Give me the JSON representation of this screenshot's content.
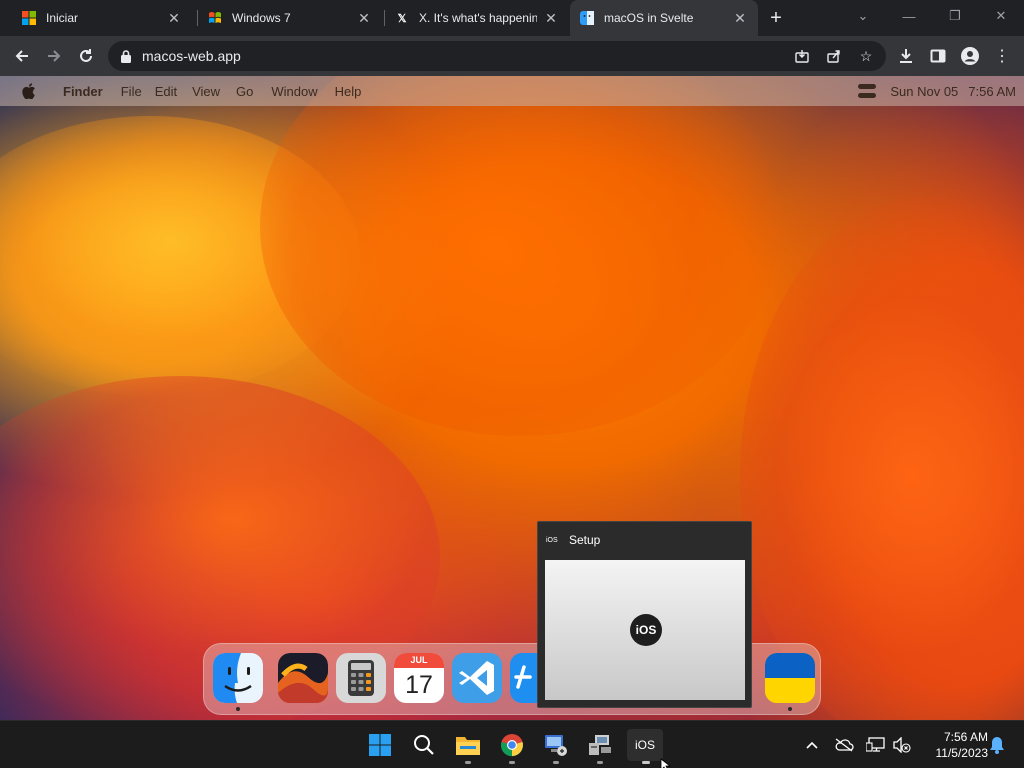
{
  "browser": {
    "tabs": [
      {
        "title": "Iniciar",
        "icon": "windows-logo-icon",
        "active": false
      },
      {
        "title": "Windows 7",
        "icon": "windows7-logo-icon",
        "active": false
      },
      {
        "title": "X. It's what's happening",
        "icon": "x-logo-icon",
        "active": false
      },
      {
        "title": "macOS in Svelte",
        "icon": "finder-icon",
        "active": true
      }
    ],
    "new_tab_label": "+",
    "url": "macos-web.app"
  },
  "macos": {
    "menubar": {
      "items": [
        "Finder",
        "File",
        "Edit",
        "View",
        "Go",
        "Window",
        "Help"
      ],
      "date": "Sun Nov 05",
      "time": "7:56 AM"
    },
    "dock": {
      "apps": [
        {
          "name": "Finder",
          "icon": "finder-icon",
          "running": true
        },
        {
          "name": "Wallpapers",
          "icon": "wallpaper-icon",
          "running": false
        },
        {
          "name": "Calculator",
          "icon": "calculator-icon",
          "running": false
        },
        {
          "name": "Calendar",
          "icon": "calendar-icon",
          "running": false,
          "month": "JUL",
          "day": "17"
        },
        {
          "name": "VS Code",
          "icon": "vscode-icon",
          "running": false
        },
        {
          "name": "App Store",
          "icon": "app-store-icon",
          "running": false
        },
        {
          "name": "Ukraine",
          "icon": "ukraine-flag-icon",
          "running": true
        }
      ]
    }
  },
  "thumbnail": {
    "icon_label": "iOS",
    "title": "Setup",
    "logo": "iOS"
  },
  "taskbar": {
    "apps": [
      {
        "name": "Start",
        "icon": "windows-start-icon"
      },
      {
        "name": "Search",
        "icon": "search-icon"
      },
      {
        "name": "File Explorer",
        "icon": "folder-icon",
        "running": true
      },
      {
        "name": "Google Chrome",
        "icon": "chrome-icon",
        "running": true
      },
      {
        "name": "Remote Desktop",
        "icon": "remote-desktop-icon",
        "running": true
      },
      {
        "name": "Computer",
        "icon": "computer-icon",
        "running": true
      },
      {
        "name": "iOS",
        "icon": "ios-app-icon",
        "label": "iOS",
        "running": true,
        "active": true
      }
    ],
    "clock_time": "7:56 AM",
    "clock_date": "11/5/2023"
  },
  "colors": {
    "chrome_bg": "#202124",
    "chrome_toolbar": "#35363a",
    "taskbar_bg": "#1c1c1c",
    "accent_windows": "#0078d4"
  }
}
